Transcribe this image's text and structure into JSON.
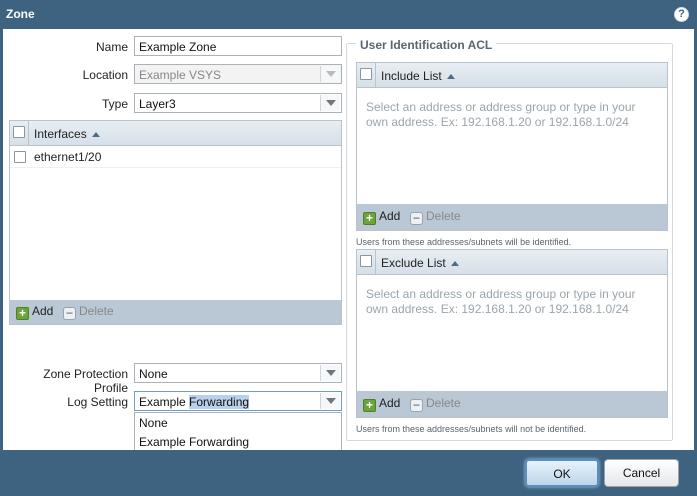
{
  "dialog": {
    "title": "Zone",
    "help_icon": "?"
  },
  "form": {
    "name_label": "Name",
    "name_value": "Example Zone",
    "location_label": "Location",
    "location_value": "Example VSYS",
    "type_label": "Type",
    "type_value": "Layer3",
    "zone_protection_label": "Zone Protection Profile",
    "zone_protection_value": "None",
    "log_setting_label": "Log Setting",
    "log_setting_value_part1": "Example",
    "log_setting_value_part2": "Forwarding"
  },
  "interfaces": {
    "header": "Interfaces",
    "rows": [
      "ethernet1/20"
    ],
    "add_label": "Add",
    "delete_label": "Delete"
  },
  "acl": {
    "legend": "User Identification ACL",
    "include": {
      "header": "Include List",
      "placeholder": "Select an address or address group or type in your own address. Ex: 192.168.1.20 or 192.168.1.0/24",
      "add_label": "Add",
      "delete_label": "Delete",
      "note": "Users from these addresses/subnets will be identified."
    },
    "exclude": {
      "header": "Exclude List",
      "placeholder": "Select an address or address group or type in your own address. Ex: 192.168.1.20 or 192.168.1.0/24",
      "add_label": "Add",
      "delete_label": "Delete",
      "note": "Users from these addresses/subnets will not be identified."
    }
  },
  "log_setting_menu": {
    "options": [
      "None",
      "Example Forwarding"
    ]
  },
  "footer": {
    "ok_label": "OK",
    "cancel_label": "Cancel"
  },
  "colors": {
    "frame": "#3d6380",
    "grid_header": "#d6e0e8",
    "grid_footer": "#b9c8d4",
    "add_icon": "#6ca33a",
    "ok_border": "#5d8fbd"
  },
  "icons": {
    "help": "help-icon",
    "add": "plus-icon",
    "delete": "minus-icon",
    "sort": "sort-ascending-icon",
    "dropdown": "chevron-down-icon"
  }
}
